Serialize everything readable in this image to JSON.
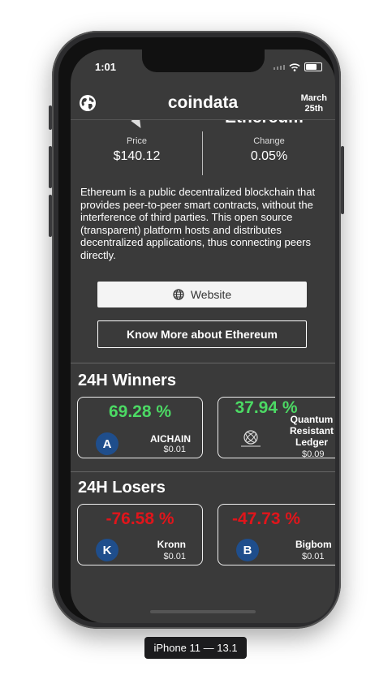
{
  "status": {
    "time": "1:01"
  },
  "header": {
    "brand": "coindata",
    "date_line1": "March",
    "date_line2": "25th"
  },
  "coin": {
    "name_partial": "Ethereum",
    "price_label": "Price",
    "price_value": "$140.12",
    "change_label": "Change",
    "change_value": "0.05%",
    "description": "Ethereum is a public decentralized blockchain that provides peer-to-peer smart contracts, without the interference of third parties. This open source (transparent) platform hosts and distributes decentralized applications, thus connecting peers directly.",
    "website_label": "Website",
    "know_more_label": "Know More about Ethereum"
  },
  "winners": {
    "title": "24H Winners",
    "cards": [
      {
        "percent": "69.28 %",
        "avatar": "A",
        "name": "AICHAIN",
        "price": "$0.01"
      },
      {
        "percent": "37.94 %",
        "name_line1": "Quantum",
        "name_line2": "Resistant",
        "name_line3": "Ledger",
        "price": "$0.09"
      }
    ]
  },
  "losers": {
    "title": "24H Losers",
    "cards": [
      {
        "percent": "-76.58 %",
        "avatar": "K",
        "name": "Kronn",
        "price": "$0.01"
      },
      {
        "percent": "-47.73 %",
        "avatar": "B",
        "name": "Bigbom",
        "price": "$0.01"
      }
    ]
  },
  "device_label": "iPhone 11 — 13.1",
  "colors": {
    "winner": "#4cd964",
    "loser": "#e0151b",
    "background": "#3a3a3a",
    "avatar": "#1f4e8c"
  }
}
